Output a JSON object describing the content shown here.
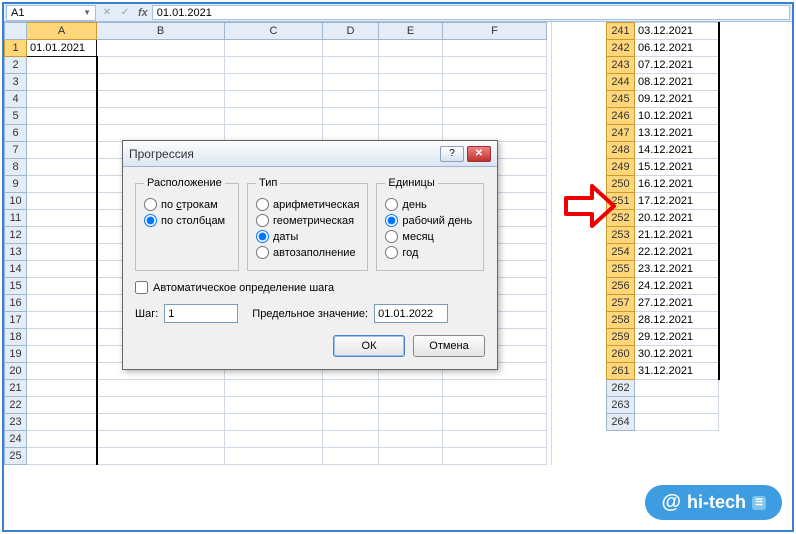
{
  "formula_bar": {
    "name_box": "A1",
    "fx_label": "fx",
    "value": "01.01.2021"
  },
  "left_columns": [
    "A",
    "B",
    "C",
    "D",
    "E",
    "F"
  ],
  "left_col_widths": [
    70,
    128,
    98,
    56,
    64,
    104
  ],
  "left_rows": [
    1,
    2,
    3,
    4,
    5,
    6,
    7,
    8,
    9,
    10,
    11,
    12,
    13,
    14,
    15,
    16,
    17,
    18,
    19,
    20,
    21,
    22,
    23,
    24,
    25
  ],
  "cell_a1": "01.01.2021",
  "dialog": {
    "title": "Прогрессия",
    "group1": {
      "legend": "Расположение",
      "opt_rows": "по строкам",
      "opt_cols": "по столбцам"
    },
    "group2": {
      "legend": "Тип",
      "opt_arith": "арифметическая",
      "opt_geom": "геометрическая",
      "opt_dates": "даты",
      "opt_auto": "автозаполнение"
    },
    "group3": {
      "legend": "Единицы",
      "opt_day": "день",
      "opt_workday": "рабочий день",
      "opt_month": "месяц",
      "opt_year": "год"
    },
    "auto_step_label": "Автоматическое определение шага",
    "step_label": "Шаг:",
    "step_value": "1",
    "limit_label": "Предельное значение:",
    "limit_value": "01.01.2022",
    "ok": "ОК",
    "cancel": "Отмена"
  },
  "right_rows": [
    {
      "n": 241,
      "v": "03.12.2021"
    },
    {
      "n": 242,
      "v": "06.12.2021"
    },
    {
      "n": 243,
      "v": "07.12.2021"
    },
    {
      "n": 244,
      "v": "08.12.2021"
    },
    {
      "n": 245,
      "v": "09.12.2021"
    },
    {
      "n": 246,
      "v": "10.12.2021"
    },
    {
      "n": 247,
      "v": "13.12.2021"
    },
    {
      "n": 248,
      "v": "14.12.2021"
    },
    {
      "n": 249,
      "v": "15.12.2021"
    },
    {
      "n": 250,
      "v": "16.12.2021"
    },
    {
      "n": 251,
      "v": "17.12.2021"
    },
    {
      "n": 252,
      "v": "20.12.2021"
    },
    {
      "n": 253,
      "v": "21.12.2021"
    },
    {
      "n": 254,
      "v": "22.12.2021"
    },
    {
      "n": 255,
      "v": "23.12.2021"
    },
    {
      "n": 256,
      "v": "24.12.2021"
    },
    {
      "n": 257,
      "v": "27.12.2021"
    },
    {
      "n": 258,
      "v": "28.12.2021"
    },
    {
      "n": 259,
      "v": "29.12.2021"
    },
    {
      "n": 260,
      "v": "30.12.2021"
    },
    {
      "n": 261,
      "v": "31.12.2021"
    }
  ],
  "right_empty_rows": [
    262,
    263,
    264
  ],
  "watermark": {
    "at": "@",
    "text": "hi-tech",
    "badge": "—"
  }
}
